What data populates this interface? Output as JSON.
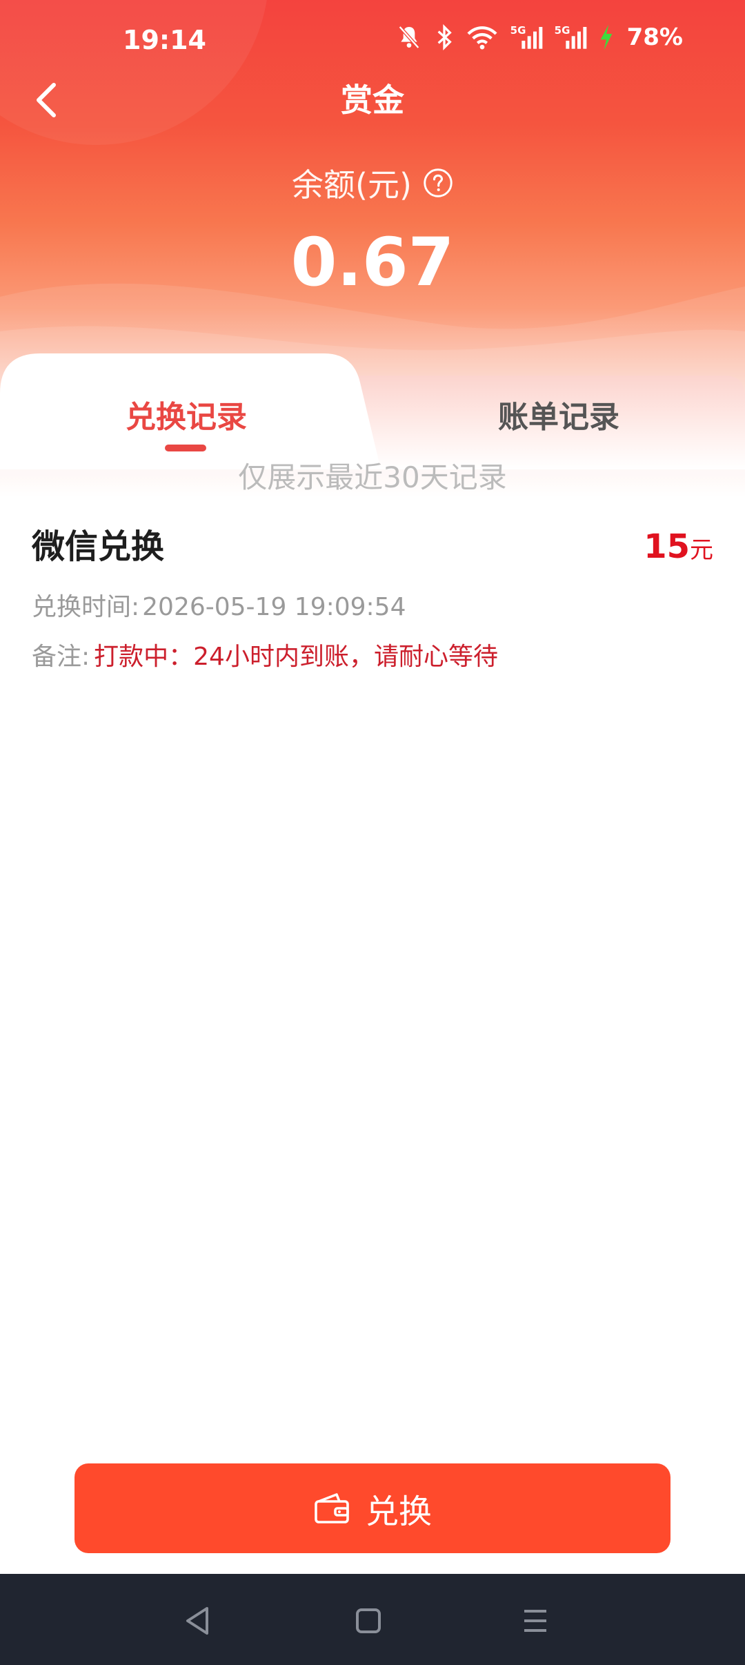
{
  "status_bar": {
    "time": "19:14",
    "battery": "78%",
    "signal_label_1": "5G",
    "signal_label_2": "5G",
    "icons": [
      "bell-off-icon",
      "bluetooth-icon",
      "wifi-icon",
      "signal-icon",
      "signal-icon",
      "charging-icon"
    ]
  },
  "nav": {
    "title": "赏金",
    "back_icon": "chevron-left-icon"
  },
  "balance": {
    "label": "余额(元)",
    "help_icon": "question-circle-icon",
    "value": "0.67"
  },
  "tabs": [
    {
      "label": "兑换记录",
      "active": true
    },
    {
      "label": "账单记录",
      "active": false
    }
  ],
  "notice": "仅展示最近30天记录",
  "records": [
    {
      "title": "微信兑换",
      "amount": "15",
      "unit": "元",
      "time_label": "兑换时间:",
      "time_value": "2026-05-19 19:09:54",
      "note_label": "备注:",
      "note_value": "打款中：24小时内到账，请耐心等待"
    }
  ],
  "exchange_button": {
    "label": "兑换",
    "icon": "wallet-icon"
  },
  "system_nav": {
    "icons": [
      "back-triangle-icon",
      "home-square-icon",
      "menu-lines-icon"
    ]
  },
  "colors": {
    "header_top": "#f4433e",
    "header_mid": "#f8774f",
    "accent": "#e94743",
    "amount": "#e0121f",
    "note": "#cc1f2c",
    "button": "#ff4a2c",
    "system_nav": "#202530"
  }
}
